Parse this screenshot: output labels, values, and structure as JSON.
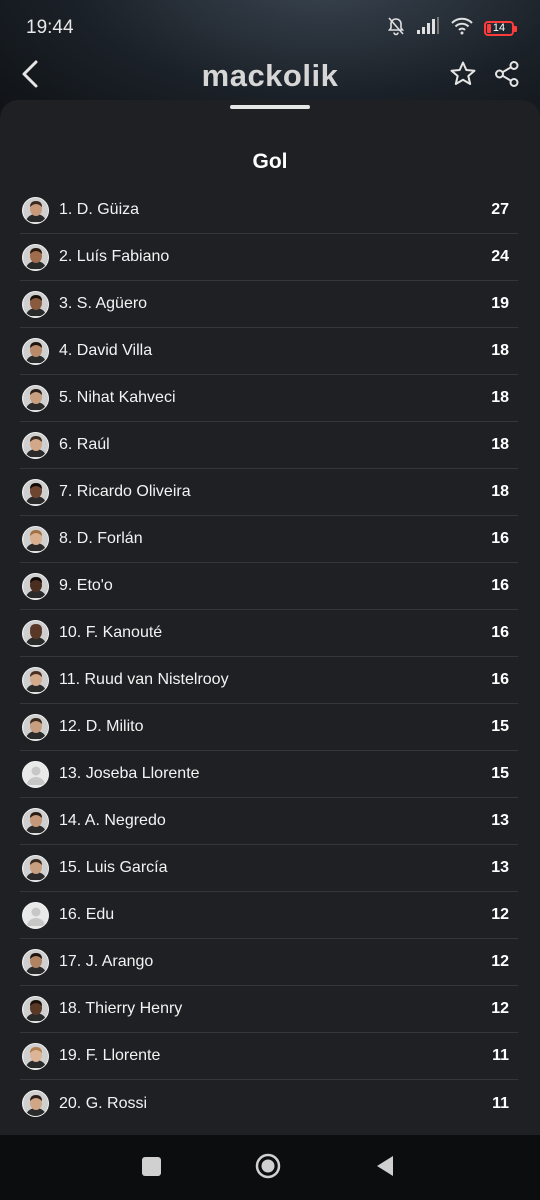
{
  "status_bar": {
    "time": "19:44",
    "battery": "14",
    "icons": [
      "bell-off-icon",
      "signal-icon",
      "wifi-icon",
      "battery-icon"
    ],
    "battery_color": "#ff3b3b"
  },
  "header": {
    "logo": "mackolik",
    "icons": [
      "back-arrow-icon",
      "star-icon",
      "share-icon"
    ]
  },
  "sheet": {
    "title": "Gol",
    "background": "#1e2023"
  },
  "players": [
    {
      "name": "1. D. Güiza",
      "goals": "27",
      "skin": "#c99a7a",
      "hair": "#3a2a20",
      "placeholder": false
    },
    {
      "name": "2. Luís Fabiano",
      "goals": "24",
      "skin": "#a06c4e",
      "hair": "#2a1a10",
      "placeholder": false
    },
    {
      "name": "3. S. Agüero",
      "goals": "19",
      "skin": "#8a5a3e",
      "hair": "#1a1008",
      "placeholder": false
    },
    {
      "name": "4. David Villa",
      "goals": "18",
      "skin": "#b88a6a",
      "hair": "#1e1510",
      "placeholder": false
    },
    {
      "name": "5. Nihat Kahveci",
      "goals": "18",
      "skin": "#c8a080",
      "hair": "#2b1f18",
      "placeholder": false
    },
    {
      "name": "6. Raúl",
      "goals": "18",
      "skin": "#d2a888",
      "hair": "#3b2a1e",
      "placeholder": false
    },
    {
      "name": "7. Ricardo Oliveira",
      "goals": "18",
      "skin": "#6e4630",
      "hair": "#120b06",
      "placeholder": false
    },
    {
      "name": "8. D. Forlán",
      "goals": "16",
      "skin": "#d8b090",
      "hair": "#a07040",
      "placeholder": false
    },
    {
      "name": "9. Eto'o",
      "goals": "16",
      "skin": "#4a2e20",
      "hair": "#0d0805",
      "placeholder": false
    },
    {
      "name": "10. F. Kanouté",
      "goals": "16",
      "skin": "#5a3828",
      "hair": "#5a3828",
      "placeholder": false
    },
    {
      "name": "11. Ruud van Nistelrooy",
      "goals": "16",
      "skin": "#d4aa8c",
      "hair": "#4a3020",
      "placeholder": false
    },
    {
      "name": "12. D. Milito",
      "goals": "15",
      "skin": "#c89e80",
      "hair": "#3a2a1e",
      "placeholder": false
    },
    {
      "name": "13. Joseba Llorente",
      "goals": "15",
      "skin": "",
      "hair": "",
      "placeholder": true
    },
    {
      "name": "14. A. Negredo",
      "goals": "13",
      "skin": "#c49878",
      "hair": "#2a1c14",
      "placeholder": false
    },
    {
      "name": "15. Luis García",
      "goals": "13",
      "skin": "#c8a080",
      "hair": "#3c2c20",
      "placeholder": false
    },
    {
      "name": "16. Edu",
      "goals": "12",
      "skin": "",
      "hair": "",
      "placeholder": true
    },
    {
      "name": "17. J. Arango",
      "goals": "12",
      "skin": "#b08462",
      "hair": "#1e1510",
      "placeholder": false
    },
    {
      "name": "18. Thierry Henry",
      "goals": "12",
      "skin": "#5a3826",
      "hair": "#1a100a",
      "placeholder": false
    },
    {
      "name": "19. F. Llorente",
      "goals": "11",
      "skin": "#dcb498",
      "hair": "#b08050",
      "placeholder": false
    },
    {
      "name": "20. G. Rossi",
      "goals": "11",
      "skin": "#d0a686",
      "hair": "#2e2018",
      "placeholder": false
    }
  ],
  "nav_bar": {
    "icons": [
      "recents-square-icon",
      "home-circle-icon",
      "back-triangle-icon"
    ]
  }
}
